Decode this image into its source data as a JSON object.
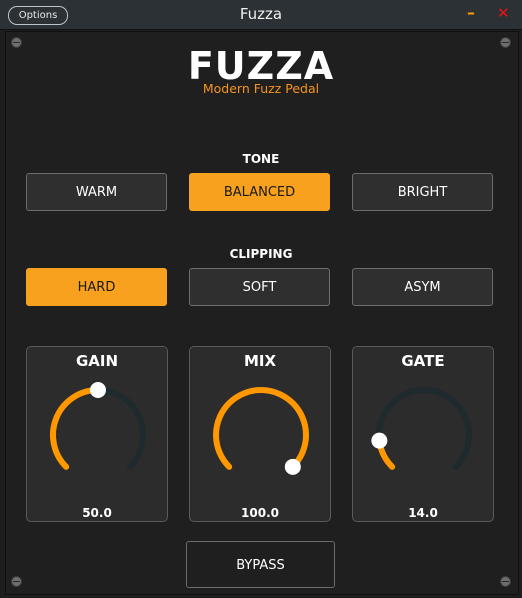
{
  "window": {
    "options_label": "Options",
    "title": "Fuzza",
    "minimize_glyph": "–",
    "close_glyph": "✕"
  },
  "header": {
    "logo": "FUZZA",
    "subtitle": "Modern Fuzz Pedal",
    "accent_color": "#f7941d"
  },
  "tone": {
    "label": "TONE",
    "options": [
      "WARM",
      "BALANCED",
      "BRIGHT"
    ],
    "selected": "BALANCED"
  },
  "clipping": {
    "label": "CLIPPING",
    "options": [
      "HARD",
      "SOFT",
      "ASYM"
    ],
    "selected": "HARD"
  },
  "knobs": [
    {
      "label": "GAIN",
      "value": "50.0",
      "fraction": 0.5
    },
    {
      "label": "MIX",
      "value": "100.0",
      "fraction": 1.0
    },
    {
      "label": "GATE",
      "value": "14.0",
      "fraction": 0.14
    }
  ],
  "bypass": {
    "label": "BYPASS"
  },
  "colors": {
    "active": "#f7a11e",
    "track": "#1f2a2e",
    "arc": "#ff9800"
  }
}
